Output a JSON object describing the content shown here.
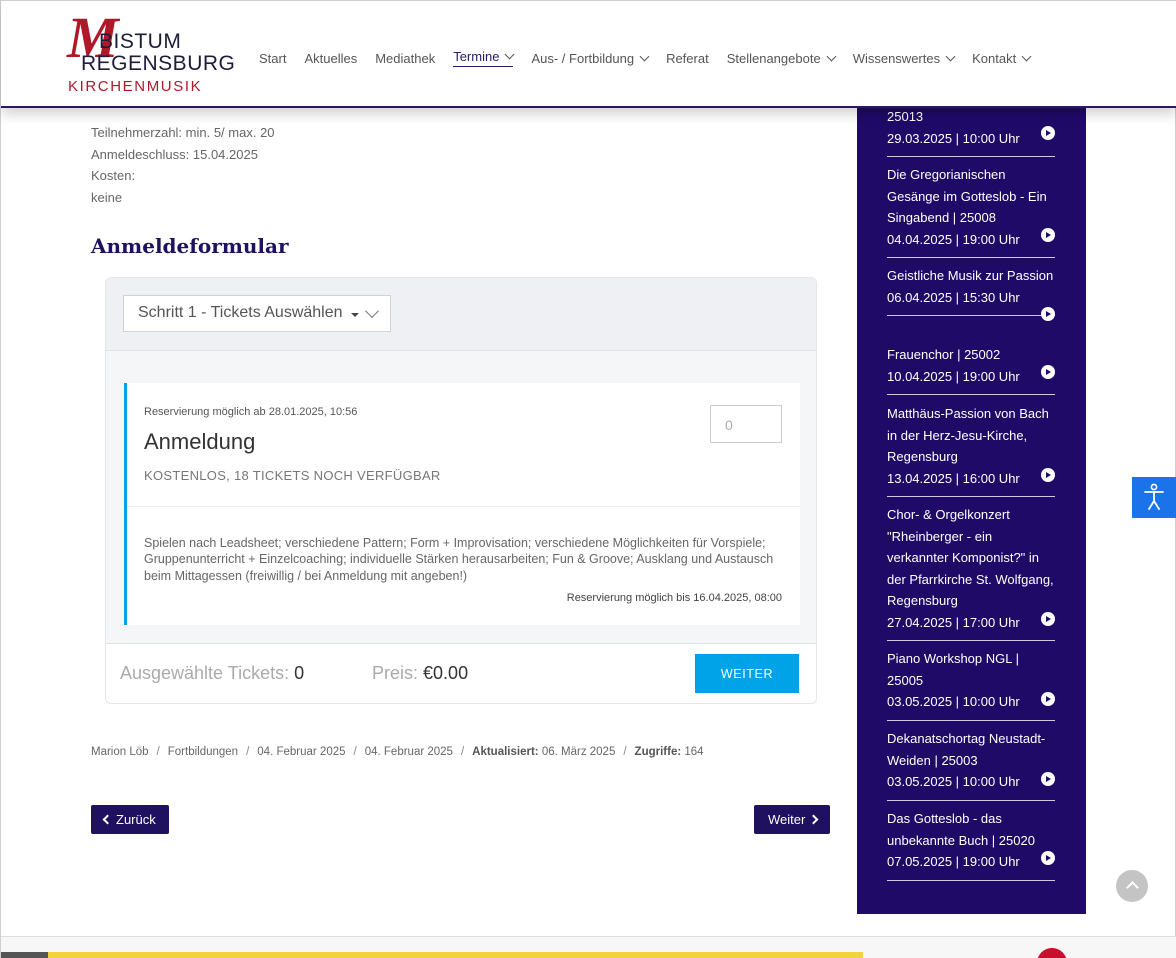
{
  "logo": {
    "m": "M",
    "line1": "BISTUM",
    "line2": "REGENSBURG",
    "line3": "KIRCHENMUSIK"
  },
  "nav": [
    {
      "label": "Start",
      "dropdown": false,
      "active": false
    },
    {
      "label": "Aktuelles",
      "dropdown": false,
      "active": false
    },
    {
      "label": "Mediathek",
      "dropdown": false,
      "active": false
    },
    {
      "label": "Termine",
      "dropdown": true,
      "active": true
    },
    {
      "label": "Aus- / Fortbildung",
      "dropdown": true,
      "active": false
    },
    {
      "label": "Referat",
      "dropdown": false,
      "active": false
    },
    {
      "label": "Stellenangebote",
      "dropdown": true,
      "active": false
    },
    {
      "label": "Wissenswertes",
      "dropdown": true,
      "active": false
    },
    {
      "label": "Kontakt",
      "dropdown": true,
      "active": false
    }
  ],
  "info": {
    "participants": "Teilnehmerzahl: min. 5/ max. 20",
    "deadline": "Anmeldeschluss: 15.04.2025",
    "costs_label": "Kosten:",
    "costs_value": "keine"
  },
  "form": {
    "title": "Anmeldeformular",
    "step_select": "Schritt 1 - Tickets Auswählen",
    "ticket": {
      "reservation_from": "Reservierung möglich ab 28.01.2025, 10:56",
      "name": "Anmeldung",
      "price_info": "KOSTENLOS, 18 TICKETS NOCH VERFÜGBAR",
      "quantity_placeholder": "0",
      "description": "Spielen nach Leadsheet; verschiedene Pattern; Form + Improvisation; verschiedene Möglichkeiten für Vorspiele; Gruppenunterricht + Einzelcoaching; individuelle Stärken herausarbeiten; Fun & Groove; Ausklang und Austausch beim Mittagessen (freiwillig / bei Anmeldung mit angeben!)",
      "reservation_until": "Reservierung möglich bis 16.04.2025, 08:00"
    },
    "selected_tickets_label": "Ausgewählte Tickets:",
    "selected_tickets_value": "0",
    "price_label": "Preis:",
    "price_value": "€0.00",
    "next_button": "WEITER"
  },
  "meta": {
    "author": "Marion Löb",
    "category": "Fortbildungen",
    "published": "04. Februar 2025",
    "created": "04. Februar 2025",
    "updated_label": "Aktualisiert:",
    "updated_value": "06. März 2025",
    "hits_label": "Zugriffe:",
    "hits_value": "164"
  },
  "pager": {
    "prev": "Zurück",
    "next": "Weiter"
  },
  "sidebar": {
    "events": [
      {
        "title": "25013",
        "date": "29.03.2025 | 10:00 Uhr"
      },
      {
        "title": "Die Gregorianischen Gesänge im Gotteslob - Ein Singabend | 25008",
        "date": "04.04.2025 | 19:00 Uhr"
      },
      {
        "title": "Geistliche Musik zur Passion",
        "date": "06.04.2025 | 15:30 Uhr"
      },
      {
        "title": "Frauenchor | 25002",
        "date": "10.04.2025 | 19:00 Uhr"
      },
      {
        "title": "Matthäus-Passion von Bach in der Herz-Jesu-Kirche, Regensburg",
        "date": "13.04.2025 | 16:00 Uhr"
      },
      {
        "title": "Chor- & Orgelkonzert \"Rheinberger - ein verkannter Komponist?\" in der Pfarrkirche St. Wolfgang, Regensburg",
        "date": "27.04.2025 | 17:00 Uhr"
      },
      {
        "title": "Piano Workshop NGL | 25005",
        "date": "03.05.2025 | 10:00 Uhr"
      },
      {
        "title": "Dekanatschortag Neustadt-Weiden | 25003",
        "date": "03.05.2025 | 10:00 Uhr"
      },
      {
        "title": "Das Gotteslob - das unbekannte Buch | 25020",
        "date": "07.05.2025 | 19:00 Uhr"
      }
    ]
  },
  "colors": {
    "brand_red": "#b0182a",
    "brand_purple": "#1f0a68",
    "accent_blue": "#00a2e8",
    "accessibility_blue": "#1a73e8"
  },
  "icons": {
    "accessibility": "accessibility-icon",
    "scroll_top": "chevron-up-icon",
    "play": "play-circle-icon"
  }
}
